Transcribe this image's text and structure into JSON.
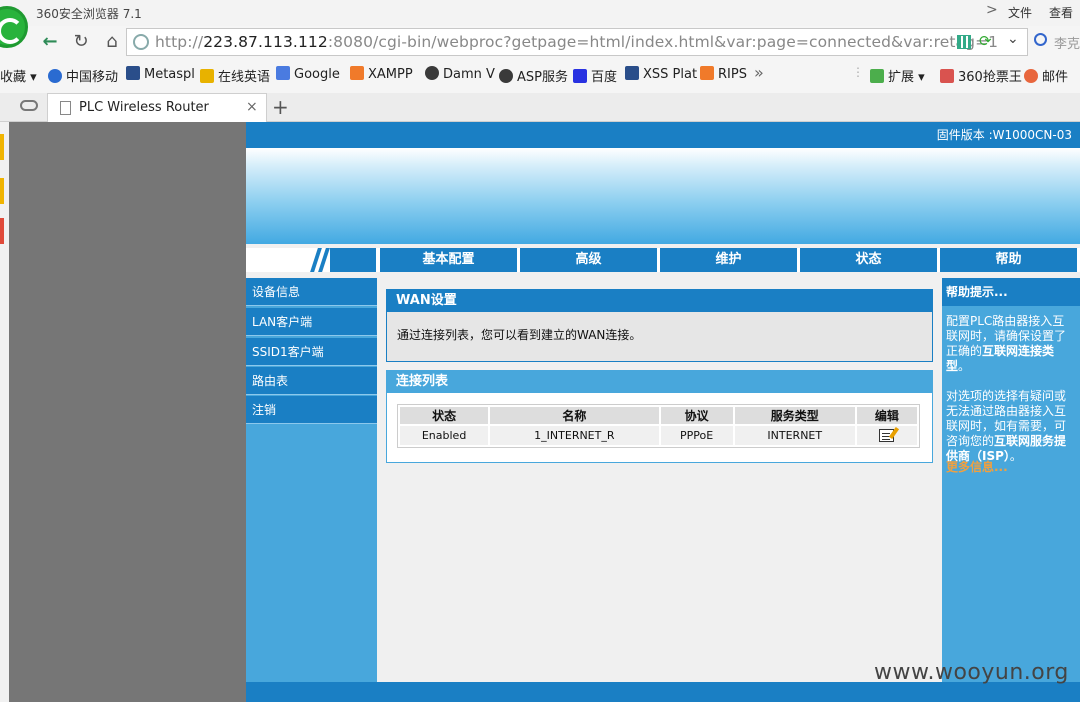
{
  "browser": {
    "app_title": "360安全浏览器 7.1",
    "menu": {
      "file": "文件",
      "view": "查看",
      "chevron": ">"
    },
    "url": {
      "scheme": "http://",
      "host": "223.87.113.112",
      "rest": ":8080/cgi-bin/webproc?getpage=html/index.html&var:page=connected&var:retag=1"
    },
    "search_placeholder": "李克",
    "bookmarks": [
      {
        "label": "收藏",
        "icon": "dropdown-icon"
      },
      {
        "label": "中国移动",
        "icon": "china-mobile-icon"
      },
      {
        "label": "Metaspl",
        "icon": "metasploit-icon"
      },
      {
        "label": "在线英语",
        "icon": "english-icon"
      },
      {
        "label": "Google",
        "icon": "google-icon"
      },
      {
        "label": "XAMPP",
        "icon": "xampp-icon"
      },
      {
        "label": "Damn V",
        "icon": "dvwa-icon"
      },
      {
        "label": "ASP服务",
        "icon": "asp-icon"
      },
      {
        "label": "百度",
        "icon": "baidu-icon"
      },
      {
        "label": "XSS Plat",
        "icon": "xss-icon"
      },
      {
        "label": "RIPS",
        "icon": "rips-icon"
      }
    ],
    "right_bookmarks": [
      {
        "label": "扩展",
        "icon": "extension-icon"
      },
      {
        "label": "360抢票王",
        "icon": "ticket-icon"
      },
      {
        "label": "邮件",
        "icon": "mail-icon"
      }
    ],
    "tab": {
      "title": "PLC Wireless Router",
      "close": "×",
      "new_tab": "+"
    }
  },
  "router": {
    "firmware_version": "固件版本 :W1000CN-03",
    "menu": [
      "基本配置",
      "高级",
      "维护",
      "状态",
      "帮助"
    ],
    "sidebar": [
      "设备信息",
      "LAN客户端",
      "SSID1客户端",
      "路由表",
      "注销"
    ],
    "wan_panel": {
      "title": "WAN设置",
      "description": "通过连接列表，您可以看到建立的WAN连接。"
    },
    "conn_panel": {
      "title": "连接列表",
      "headers": [
        "状态",
        "名称",
        "协议",
        "服务类型",
        "编辑"
      ],
      "rows": [
        {
          "status": "Enabled",
          "name": "1_INTERNET_R",
          "protocol": "PPPoE",
          "service": "INTERNET"
        }
      ]
    },
    "help": {
      "title": "帮助提示...",
      "p1_a": "配置PLC路由器接入互联网时，请确保设置了正确的",
      "p1_b": "互联网连接类型",
      "p1_c": "。",
      "p2_a": "对选项的选择有疑问或无法通过路由器接入互联网时，如有需要，可咨询您的",
      "p2_b": "互联网服务提供商（ISP）",
      "p2_c": "。",
      "more": "更多信息..."
    }
  },
  "watermark": "www.wooyun.org"
}
